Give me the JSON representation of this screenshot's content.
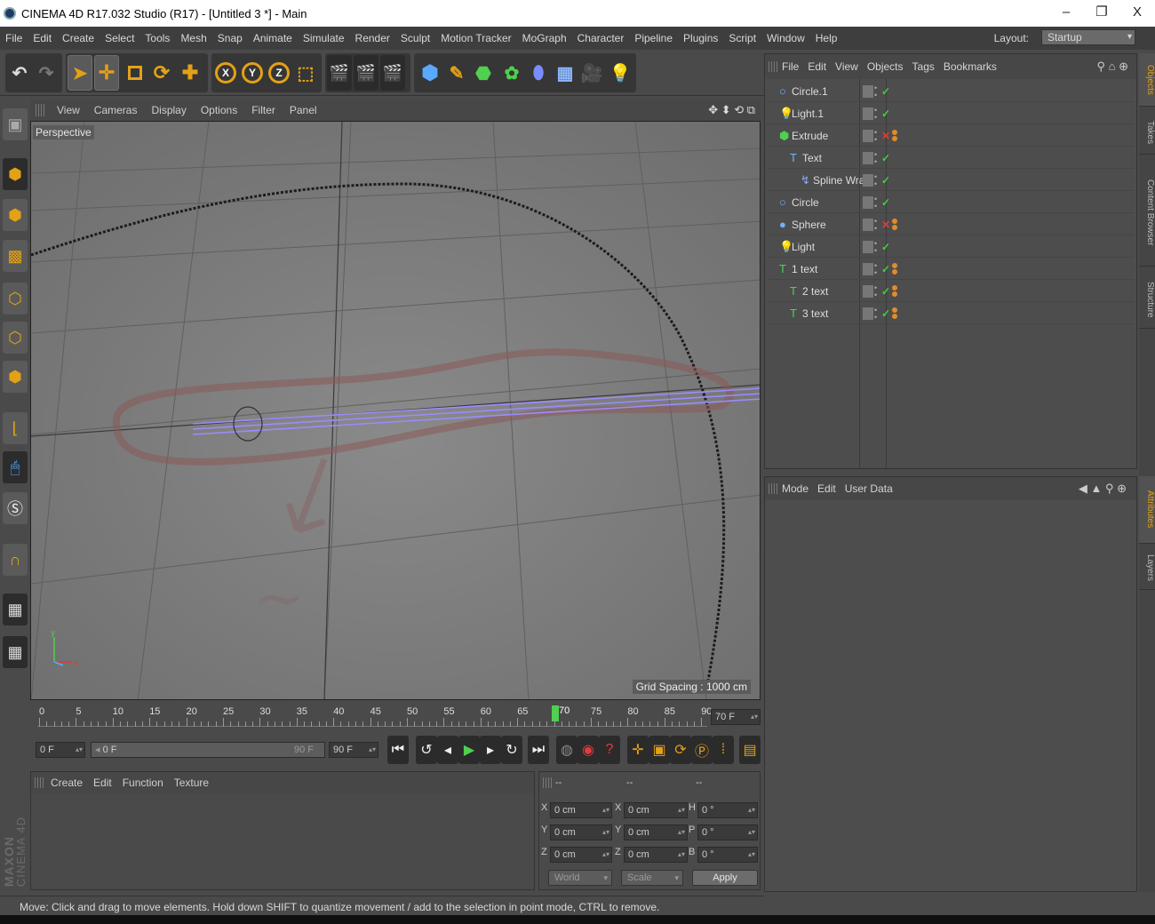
{
  "window": {
    "title": "CINEMA 4D R17.032 Studio (R17) - [Untitled 3 *] - Main",
    "minimize": "–",
    "restore": "❐",
    "close": "X"
  },
  "menu": [
    "File",
    "Edit",
    "Create",
    "Select",
    "Tools",
    "Mesh",
    "Snap",
    "Animate",
    "Simulate",
    "Render",
    "Sculpt",
    "Motion Tracker",
    "MoGraph",
    "Character",
    "Pipeline",
    "Plugins",
    "Script",
    "Window",
    "Help"
  ],
  "layout": {
    "label": "Layout:",
    "value": "Startup"
  },
  "toolbar": {
    "x": "X",
    "y": "Y",
    "z": "Z"
  },
  "viewport": {
    "menu": [
      "View",
      "Cameras",
      "Display",
      "Options",
      "Filter",
      "Panel"
    ],
    "label": "Perspective",
    "grid_spacing": "Grid Spacing : 1000 cm",
    "circle_text": "OF THESE DIFFERENT PIECES OF INFORMATION IN THE SAME PROCESS IS DETERMINED BY THE SENSORY MEMORY OR THE SHORT-TERM MEMORY..."
  },
  "timeline": {
    "ticks": [
      "0",
      "5",
      "10",
      "15",
      "20",
      "25",
      "30",
      "35",
      "40",
      "45",
      "50",
      "55",
      "60",
      "65",
      "70",
      "75",
      "80",
      "85",
      "90"
    ],
    "current": "70",
    "frame_field": "70 F"
  },
  "transport": {
    "start": "0 F",
    "range_start": "0 F",
    "range_end": "90 F",
    "end": "90 F"
  },
  "material": {
    "menu": [
      "Create",
      "Edit",
      "Function",
      "Texture"
    ]
  },
  "coords": {
    "headers": [
      "--",
      "--",
      "--"
    ],
    "rows": [
      {
        "a1": "X",
        "v1": "0 cm",
        "a2": "X",
        "v2": "0 cm",
        "a3": "H",
        "v3": "0 °"
      },
      {
        "a1": "Y",
        "v1": "0 cm",
        "a2": "Y",
        "v2": "0 cm",
        "a3": "P",
        "v3": "0 °"
      },
      {
        "a1": "Z",
        "v1": "0 cm",
        "a2": "Z",
        "v2": "0 cm",
        "a3": "B",
        "v3": "0 °"
      }
    ],
    "world": "World",
    "scale": "Scale",
    "apply": "Apply"
  },
  "objects": {
    "menu": [
      "File",
      "Edit",
      "View",
      "Objects",
      "Tags",
      "Bookmarks"
    ],
    "items": [
      {
        "name": "Circle.1",
        "icon": "○",
        "color": "#6fb3ff",
        "indent": 0,
        "check": "✓",
        "chkcolor": "#3cd43c",
        "tag": false
      },
      {
        "name": "Light.1",
        "icon": "💡",
        "color": "#ddd",
        "indent": 0,
        "check": "✓",
        "chkcolor": "#3cd43c",
        "tag": false
      },
      {
        "name": "Extrude",
        "icon": "⬢",
        "color": "#4fd04f",
        "indent": 0,
        "check": "✕",
        "chkcolor": "#e23b3b",
        "tag": true
      },
      {
        "name": "Text",
        "icon": "T",
        "color": "#6fb3ff",
        "indent": 1,
        "check": "✓",
        "chkcolor": "#3cd43c",
        "tag": false
      },
      {
        "name": "Spline Wrap",
        "icon": "↯",
        "color": "#8aa8ff",
        "indent": 2,
        "check": "✓",
        "chkcolor": "#3cd43c",
        "tag": false
      },
      {
        "name": "Circle",
        "icon": "○",
        "color": "#6fb3ff",
        "indent": 0,
        "check": "✓",
        "chkcolor": "#3cd43c",
        "tag": false
      },
      {
        "name": "Sphere",
        "icon": "●",
        "color": "#6fb3ff",
        "indent": 0,
        "check": "✕",
        "chkcolor": "#e23b3b",
        "tag": true
      },
      {
        "name": "Light",
        "icon": "💡",
        "color": "#ddd",
        "indent": 0,
        "check": "✓",
        "chkcolor": "#3cd43c",
        "tag": false
      },
      {
        "name": "1 text",
        "icon": "T",
        "color": "#4fd04f",
        "indent": 0,
        "check": "✓",
        "chkcolor": "#3cd43c",
        "tag": true
      },
      {
        "name": "2 text",
        "icon": "T",
        "color": "#4fd04f",
        "indent": 1,
        "check": "✓",
        "chkcolor": "#3cd43c",
        "tag": true
      },
      {
        "name": "3 text",
        "icon": "T",
        "color": "#4fd04f",
        "indent": 1,
        "check": "✓",
        "chkcolor": "#3cd43c",
        "tag": true
      }
    ]
  },
  "attributes": {
    "menu": [
      "Mode",
      "Edit",
      "User Data"
    ]
  },
  "side_tabs": [
    "Objects",
    "Takes",
    "Content Browser",
    "Structure",
    "Attributes",
    "Layers"
  ],
  "status": "Move: Click and drag to move elements. Hold down SHIFT to quantize movement / add to the selection in point mode, CTRL to remove.",
  "brand": {
    "line1": "MAXON",
    "line2": "CINEMA 4D"
  },
  "colors": {
    "accent": "#e3a116",
    "selection": "#9b8cff",
    "annotation": "#8a5a5a"
  }
}
